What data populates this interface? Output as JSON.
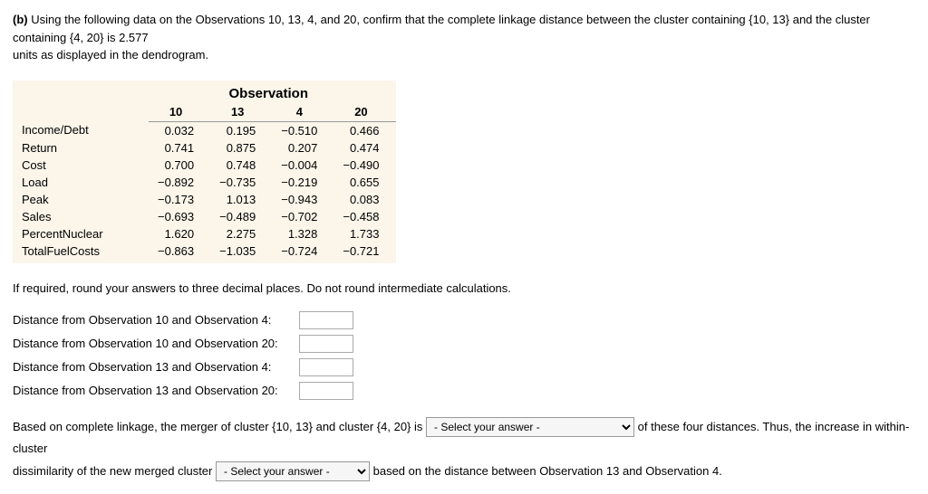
{
  "question": {
    "part_label": "(b)",
    "text_line1": "Using the following data on the Observations 10, 13, 4, and 20, confirm that the complete linkage distance between the cluster containing {10, 13} and the cluster containing {4, 20} is 2.577",
    "text_line2": "units as displayed in the dendrogram."
  },
  "table": {
    "group_header": "Observation",
    "columns": [
      "10",
      "13",
      "4",
      "20"
    ],
    "rows": [
      {
        "label": "Income/Debt",
        "values": [
          "0.032",
          "0.195",
          "−0.510",
          "0.466"
        ]
      },
      {
        "label": "Return",
        "values": [
          "0.741",
          "0.875",
          "0.207",
          "0.474"
        ]
      },
      {
        "label": "Cost",
        "values": [
          "0.700",
          "0.748",
          "−0.004",
          "−0.490"
        ]
      },
      {
        "label": "Load",
        "values": [
          "−0.892",
          "−0.735",
          "−0.219",
          "0.655"
        ]
      },
      {
        "label": "Peak",
        "values": [
          "−0.173",
          "1.013",
          "−0.943",
          "0.083"
        ]
      },
      {
        "label": "Sales",
        "values": [
          "−0.693",
          "−0.489",
          "−0.702",
          "−0.458"
        ]
      },
      {
        "label": "PercentNuclear",
        "values": [
          "1.620",
          "2.275",
          "1.328",
          "1.733"
        ]
      },
      {
        "label": "TotalFuelCosts",
        "values": [
          "−0.863",
          "−1.035",
          "−0.724",
          "−0.721"
        ]
      }
    ]
  },
  "instruction": "If required, round your answers to three decimal places. Do not round intermediate calculations.",
  "distance_prompts": [
    "Distance from Observation 10 and Observation 4:",
    "Distance from Observation 10 and Observation 20:",
    "Distance from Observation 13 and Observation 4:",
    "Distance from Observation 13 and Observation 20:"
  ],
  "bottom": {
    "seg1": "Based on complete linkage, the merger of cluster {10, 13} and cluster {4, 20} is ",
    "sel1_placeholder": "- Select your answer -",
    "seg2": " of these four distances. Thus, the increase in within-cluster",
    "seg3": "dissimilarity of the new merged cluster ",
    "sel2_placeholder": "- Select your answer -",
    "seg4": " based on the distance between Observation 13 and Observation 4."
  }
}
